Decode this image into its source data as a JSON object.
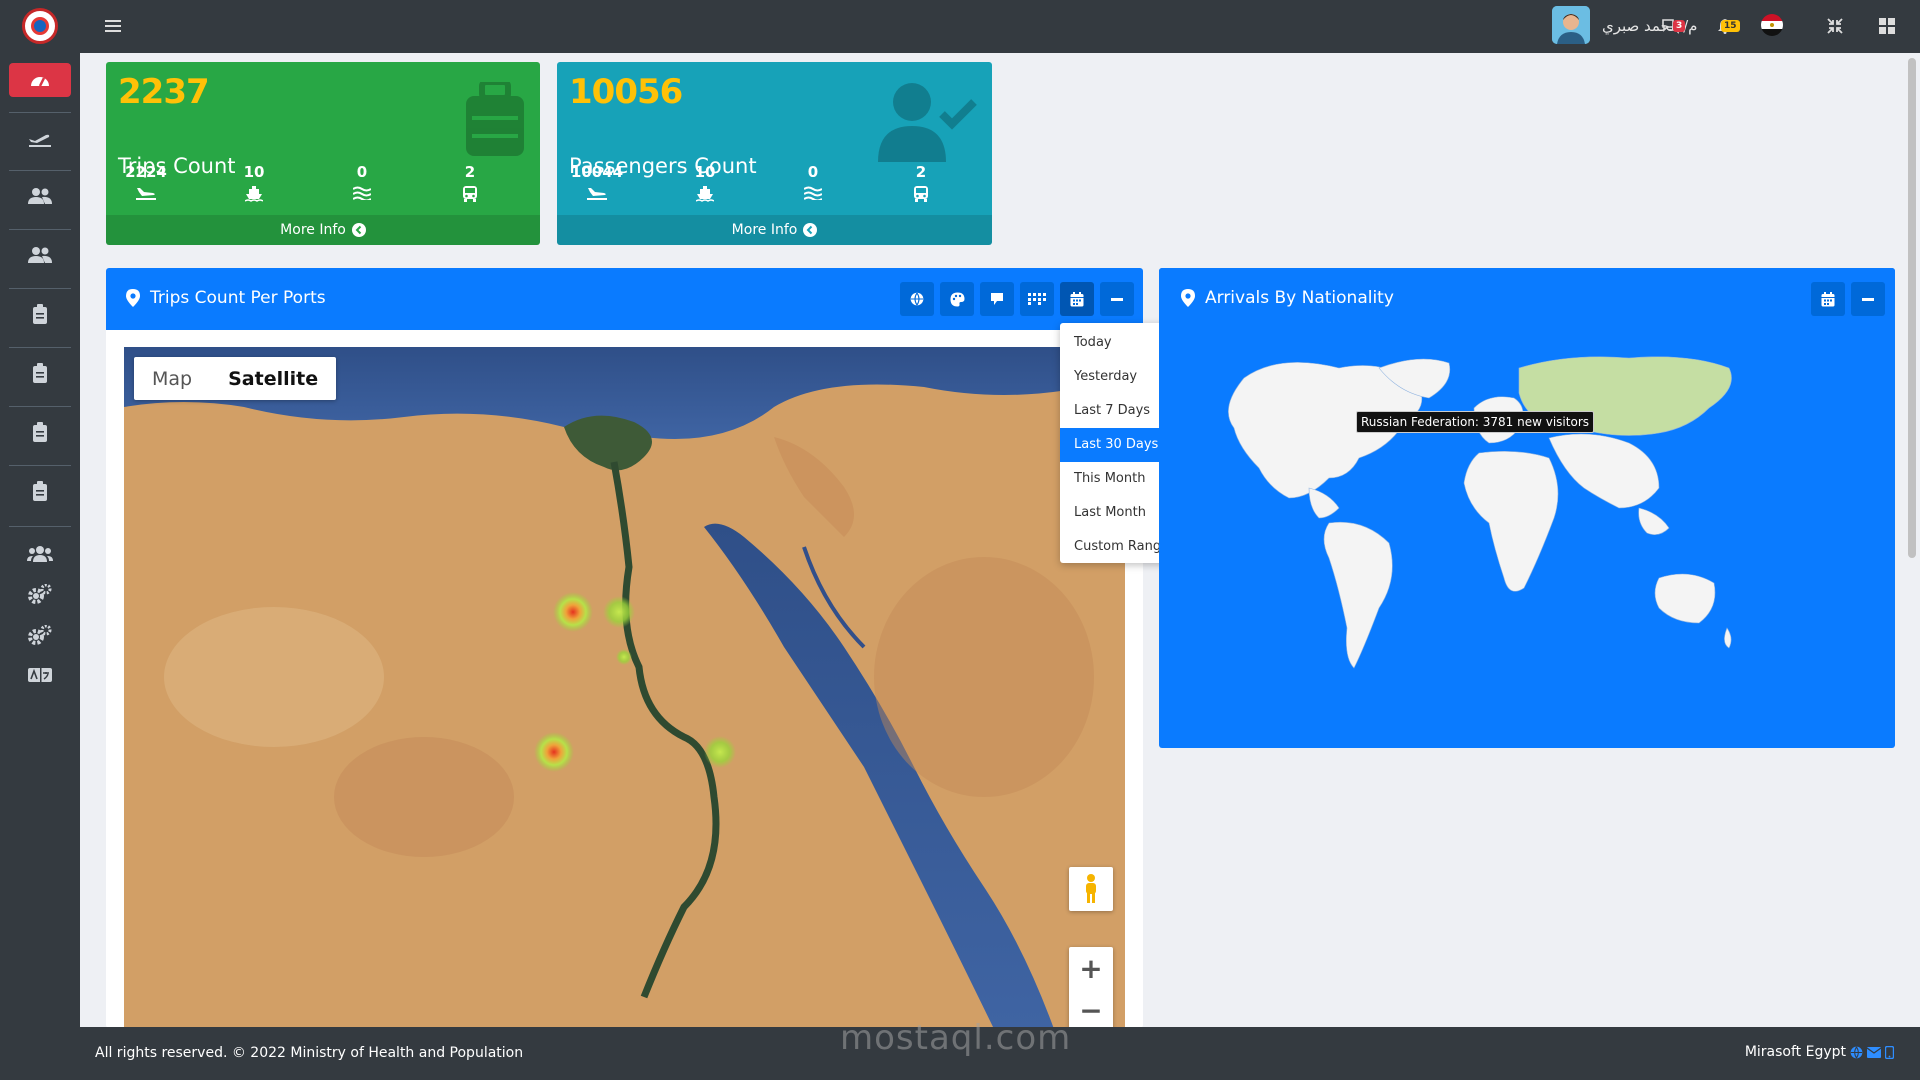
{
  "topbar": {
    "menu_icon": "hamburger-icon",
    "username": "م/ محمد صبري",
    "messages_badge": "3",
    "notifications_badge": "15",
    "flag": "egypt-flag",
    "fullscreen_icon": "compress-icon",
    "apps_icon": "grid-icon"
  },
  "sidebar": {
    "items": [
      {
        "icon": "dashboard-icon",
        "active": true
      },
      {
        "icon": "plane-departure-icon"
      },
      {
        "icon": "users-icon"
      },
      {
        "icon": "users-icon"
      },
      {
        "icon": "clipboard-icon"
      },
      {
        "icon": "clipboard-icon"
      },
      {
        "icon": "clipboard-icon"
      },
      {
        "icon": "clipboard-icon"
      },
      {
        "icon": "users-cog-icon"
      },
      {
        "icon": "cogs-icon"
      },
      {
        "icon": "cogs-icon"
      },
      {
        "icon": "language-icon"
      }
    ]
  },
  "trips_box": {
    "value": "2237",
    "label": "Trips Count",
    "color": "#28a745",
    "stats": [
      {
        "value": "2224",
        "icon": "plane-landing-icon"
      },
      {
        "value": "10",
        "icon": "ship-icon"
      },
      {
        "value": "0",
        "icon": "water-icon"
      },
      {
        "value": "2",
        "icon": "bus-icon"
      }
    ],
    "more": "More Info"
  },
  "passengers_box": {
    "value": "10056",
    "label": "Passengers Count",
    "color": "#17a2b8",
    "stats": [
      {
        "value": "10044",
        "icon": "plane-landing-icon"
      },
      {
        "value": "10",
        "icon": "ship-icon"
      },
      {
        "value": "0",
        "icon": "water-icon"
      },
      {
        "value": "2",
        "icon": "bus-icon"
      }
    ],
    "more": "More Info"
  },
  "ports_card": {
    "title": "Trips Count Per Ports",
    "tools": [
      "globe-icon",
      "palette-icon",
      "comment-icon",
      "grid-dots-icon",
      "calendar-icon",
      "minus-icon"
    ],
    "map_types": [
      "Map",
      "Satellite"
    ],
    "selected_map_type": "Satellite"
  },
  "date_dropdown": {
    "items": [
      "Today",
      "Yesterday",
      "Last 7 Days",
      "Last 30 Days",
      "This Month",
      "Last Month",
      "Custom Range"
    ],
    "selected": "Last 30 Days"
  },
  "nationality_card": {
    "title": "Arrivals By Nationality",
    "tools": [
      "calendar-icon",
      "minus-icon"
    ],
    "tooltip": "Russian Federation: 3781 new visitors",
    "highlight_color": "#c5dea3"
  },
  "footer": {
    "copyright": "All rights reserved. © 2022 Ministry of Health and Population",
    "brand": "Mirasoft Egypt"
  },
  "watermark": "mostaql.com",
  "accent": "#0a7bff"
}
